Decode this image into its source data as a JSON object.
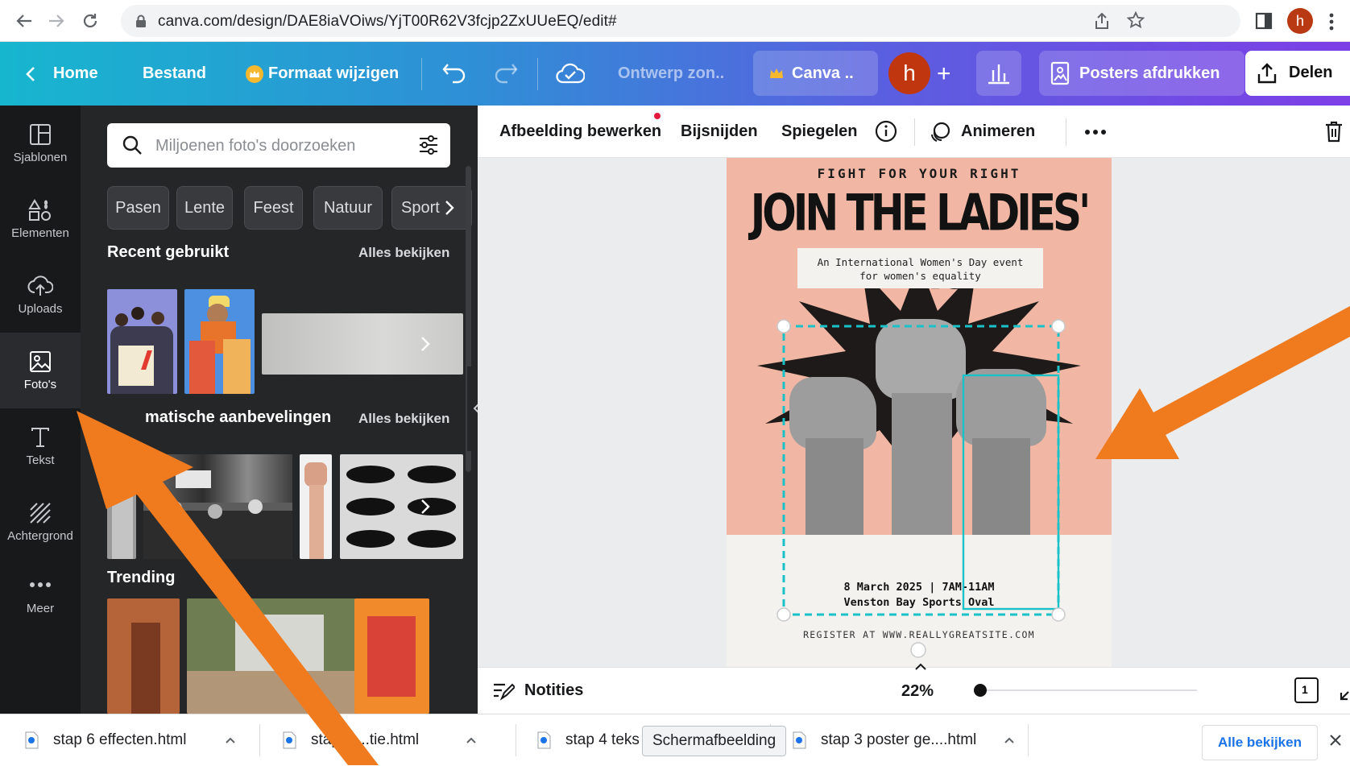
{
  "browser": {
    "url": "canva.com/design/DAE8iaVOiws/YjT00R62V3fcjp2ZxUUeEQ/edit#",
    "profile_initial": "h"
  },
  "topbar": {
    "home": "Home",
    "file": "Bestand",
    "resize": "Formaat wijzigen",
    "design_name": "Ontwerp zon..",
    "canva_pill": "Canva ..",
    "user_initial": "h",
    "add": "+",
    "print": "Posters afdrukken",
    "share": "Delen"
  },
  "leftrail": {
    "items": [
      {
        "label": "Sjablonen",
        "icon": "layout-icon"
      },
      {
        "label": "Elementen",
        "icon": "shapes-icon"
      },
      {
        "label": "Uploads",
        "icon": "cloud-upload-icon"
      },
      {
        "label": "Foto's",
        "icon": "image-icon"
      },
      {
        "label": "Tekst",
        "icon": "text-icon"
      },
      {
        "label": "Achtergrond",
        "icon": "hatch-icon"
      },
      {
        "label": "Meer",
        "icon": "more-icon"
      }
    ]
  },
  "panel": {
    "search_placeholder": "Miljoenen foto's doorzoeken",
    "chips": [
      "Pasen",
      "Lente",
      "Feest",
      "Natuur",
      "Sport"
    ],
    "recent_title": "Recent gebruikt",
    "auto_title": "matische aanbevelingen",
    "trending_title": "Trending",
    "see_all": "Alles bekijken"
  },
  "context_bar": {
    "edit_image": "Afbeelding bewerken",
    "crop": "Bijsnijden",
    "flip": "Spiegelen",
    "animate": "Animeren"
  },
  "poster": {
    "kicker": "FIGHT FOR YOUR RIGHT",
    "title": "JOIN THE LADIES' MARCH",
    "subtitle_line1": "An International Women's Day event",
    "subtitle_line2": "for women's equality",
    "date_line": "8 March 2025 | 7AM-11AM",
    "venue_line": "Venston Bay Sports Oval",
    "register": "REGISTER AT WWW.REALLYGREATSITE.COM"
  },
  "bottombar": {
    "notes": "Notities",
    "zoom": "22%",
    "page_count": "1"
  },
  "downloads": {
    "items": [
      "stap 6 effecten.html",
      "stap 5 ...tie.html",
      "stap 4 teks",
      "stap 3 poster ge....html"
    ],
    "tooltip": "Schermafbeelding",
    "view_all": "Alle bekijken"
  },
  "colors": {
    "annotation_arrow": "#f07a1e",
    "selection": "#19c2c9",
    "poster_bg": "#f2b7a4"
  }
}
